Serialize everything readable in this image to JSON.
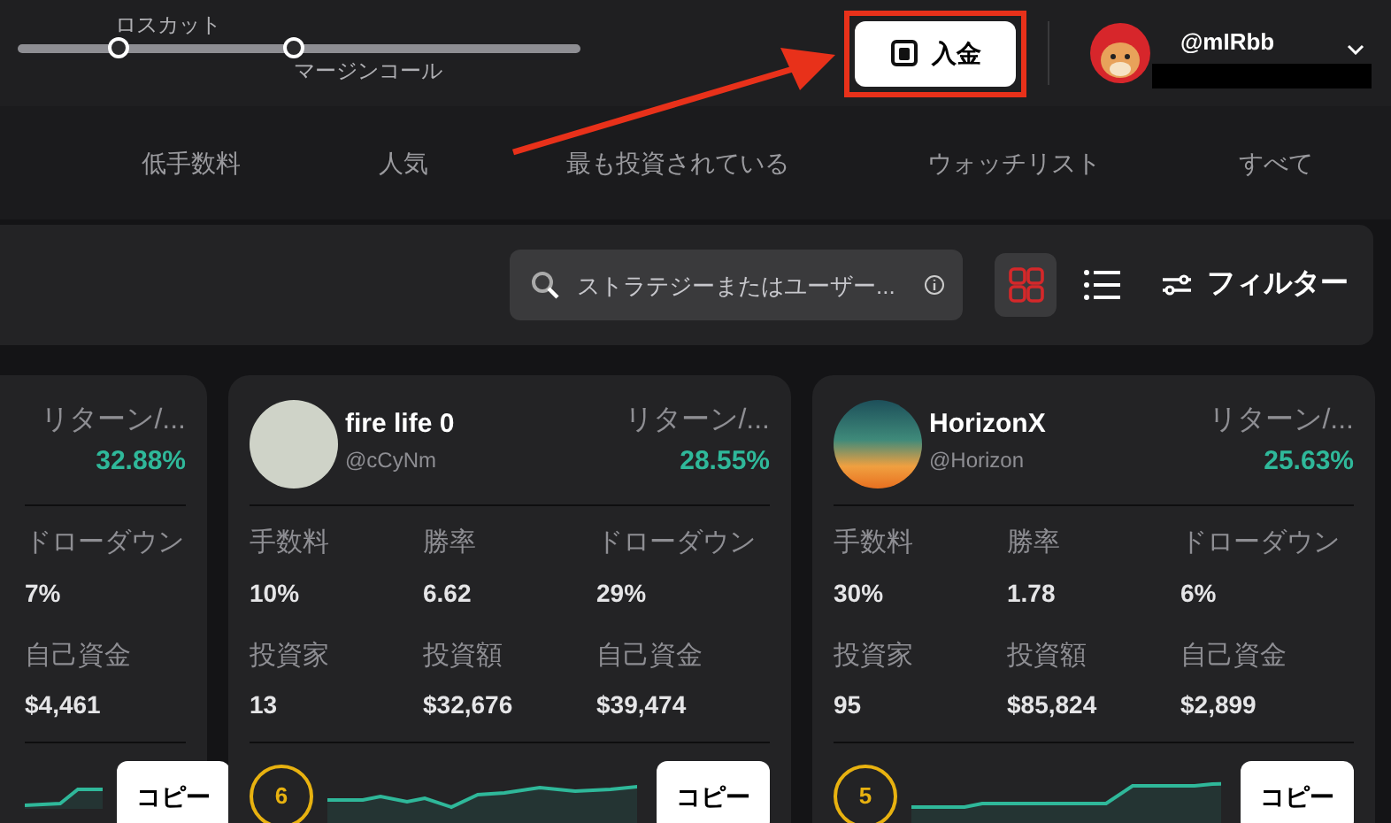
{
  "margin_slider": {
    "markers": [
      {
        "label": "ロスカット",
        "level": 0.18,
        "kind": "above"
      },
      {
        "label": "マージンコール",
        "level": 0.49,
        "kind": "below"
      }
    ]
  },
  "deposit_button": {
    "label": "入金",
    "highlighted": true
  },
  "user": {
    "name": "@mIRbb",
    "redacted": true
  },
  "tabs": [
    {
      "label": "低手数料",
      "selected": false
    },
    {
      "label": "人気",
      "selected": false
    },
    {
      "label": "最も投資されている",
      "selected": false
    },
    {
      "label": "ウォッチリスト",
      "selected": false
    },
    {
      "label": "すべて",
      "selected": false
    }
  ],
  "toolbar": {
    "search": {
      "placeholder": "ストラテジーまたはユーザー..."
    },
    "views": [
      {
        "kind": "grid",
        "selected": true
      },
      {
        "kind": "list",
        "selected": false
      }
    ],
    "filter": "フィルター"
  },
  "cards": [
    {
      "kind": "partial",
      "return_label": "リターン/...",
      "return_value": "32.88%",
      "stats": [
        {
          "label": "ドローダウン",
          "value": "7%"
        },
        {
          "label": "自己資金",
          "value": "$4,461"
        }
      ],
      "copy": "コピー"
    },
    {
      "kind": "photo",
      "name": "fire life 0",
      "handle": "@cCyNm",
      "return_label": "リターン/...",
      "return_value": "28.55%",
      "stats": [
        {
          "label": "手数料",
          "value": "10%"
        },
        {
          "label": "勝率",
          "value": "6.62"
        },
        {
          "label": "ドローダウン",
          "value": "29%"
        },
        {
          "label": "投資家",
          "value": "13"
        },
        {
          "label": "投資額",
          "value": "$32,676"
        },
        {
          "label": "自己資金",
          "value": "$39,474"
        }
      ],
      "rank": "6",
      "copy": "コピー"
    },
    {
      "kind": "logo",
      "name": "HorizonX",
      "handle": "@Horizon",
      "return_label": "リターン/...",
      "return_value": "25.63%",
      "stats": [
        {
          "label": "手数料",
          "value": "30%"
        },
        {
          "label": "勝率",
          "value": "1.78"
        },
        {
          "label": "ドローダウン",
          "value": "6%"
        },
        {
          "label": "投資家",
          "value": "95"
        },
        {
          "label": "投資額",
          "value": "$85,824"
        },
        {
          "label": "自己資金",
          "value": "$2,899"
        }
      ],
      "rank": "5",
      "copy": "コピー"
    }
  ]
}
